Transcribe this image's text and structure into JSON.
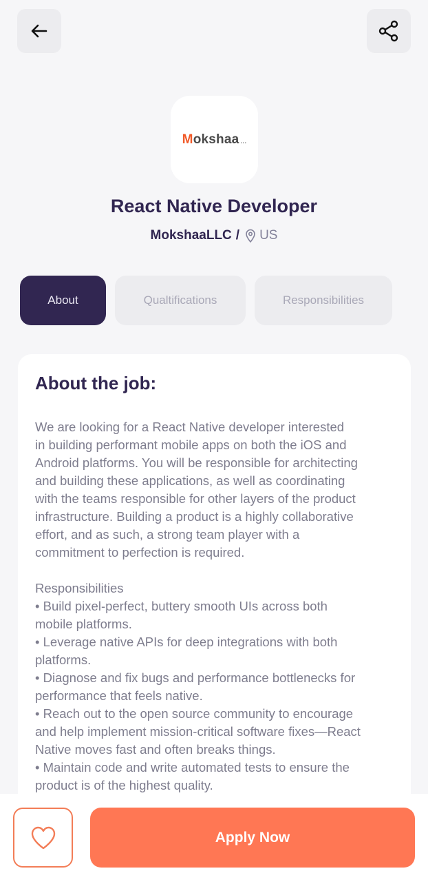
{
  "header": {
    "back_icon": "arrow-left-icon",
    "share_icon": "share-icon"
  },
  "company_logo": {
    "text_m": "M",
    "text_rest": "okshaa",
    "text_dots": "..."
  },
  "job": {
    "title": "React Native Developer",
    "company": "MokshaaLLC",
    "separator": "/",
    "location": "US"
  },
  "tabs": [
    {
      "label": "About",
      "active": true
    },
    {
      "label": "Qualtifications",
      "active": false
    },
    {
      "label": "Responsibilities",
      "active": false
    }
  ],
  "about": {
    "heading": "About the job:",
    "lines": [
      "We are looking for a React Native developer interested",
      "in building performant mobile apps on both the iOS and",
      "Android platforms. You will be responsible for architecting",
      "and building these applications, as well as coordinating",
      "with the teams responsible for other layers of the product",
      "infrastructure. Building a product is a highly collaborative",
      "effort, and as such, a strong team player with a",
      "commitment to perfection is required.",
      "",
      "Responsibilities",
      "• Build pixel-perfect, buttery smooth UIs across both",
      "mobile platforms.",
      "• Leverage native APIs for deep integrations with both",
      "platforms.",
      "• Diagnose and fix bugs and performance bottlenecks for",
      "performance that feels native.",
      "• Reach out to the open source community to encourage",
      "and help implement mission-critical software fixes—React",
      "Native moves fast and often breaks things.",
      "• Maintain code and write automated tests to ensure the",
      "product is of the highest quality."
    ]
  },
  "footer": {
    "favorite_icon": "heart-outline-icon",
    "apply_label": "Apply Now"
  },
  "colors": {
    "primary": "#312651",
    "accent": "#FF7754",
    "gray": "#83829A",
    "background": "#F6F6F8"
  }
}
